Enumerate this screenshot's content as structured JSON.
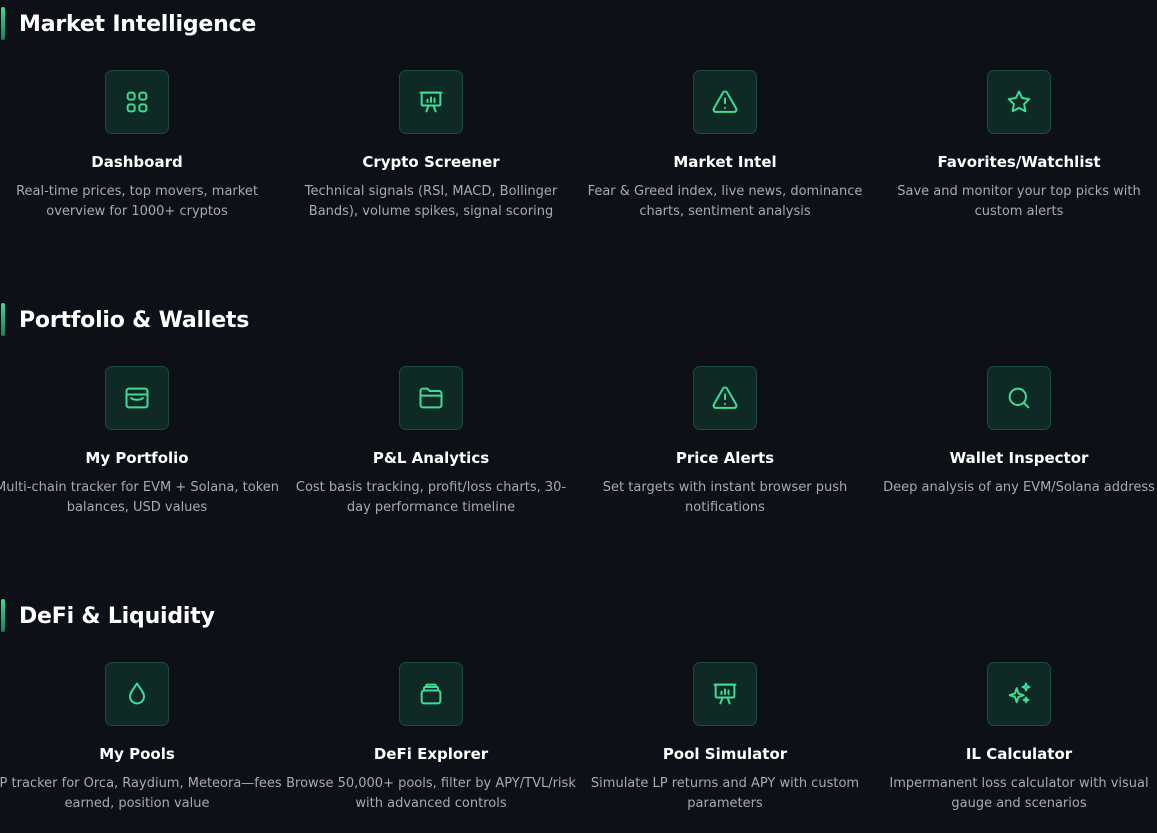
{
  "sections": [
    {
      "title": "Market Intelligence",
      "cards": [
        {
          "icon": "grid-icon",
          "title": "Dashboard",
          "desc": "Real-time prices, top movers, market overview for 1000+ cryptos"
        },
        {
          "icon": "presentation-chart-icon",
          "title": "Crypto Screener",
          "desc": "Technical signals (RSI, MACD, Bollinger Bands), volume spikes, signal scoring"
        },
        {
          "icon": "warning-triangle-icon",
          "title": "Market Intel",
          "desc": "Fear & Greed index, live news, dominance charts, sentiment analysis"
        },
        {
          "icon": "star-icon",
          "title": "Favorites/Watchlist",
          "desc": "Save and monitor your top picks with custom alerts"
        }
      ]
    },
    {
      "title": "Portfolio & Wallets",
      "cards": [
        {
          "icon": "wallet-icon",
          "title": "My Portfolio",
          "desc": "Multi-chain tracker for EVM + Solana, token balances, USD values"
        },
        {
          "icon": "folder-icon",
          "title": "P&L Analytics",
          "desc": "Cost basis tracking, profit/loss charts, 30-day performance timeline"
        },
        {
          "icon": "warning-triangle-icon",
          "title": "Price Alerts",
          "desc": "Set targets with instant browser push notifications"
        },
        {
          "icon": "search-icon",
          "title": "Wallet Inspector",
          "desc": "Deep analysis of any EVM/Solana address"
        }
      ]
    },
    {
      "title": "DeFi & Liquidity",
      "cards": [
        {
          "icon": "droplet-icon",
          "title": "My Pools",
          "desc": "LP tracker for Orca, Raydium, Meteora—fees earned, position value"
        },
        {
          "icon": "stack-icon",
          "title": "DeFi Explorer",
          "desc": "Browse 50,000+ pools, filter by APY/TVL/risk with advanced controls"
        },
        {
          "icon": "presentation-chart-icon",
          "title": "Pool Simulator",
          "desc": "Simulate LP returns and APY with custom parameters"
        },
        {
          "icon": "sparkles-icon",
          "title": "IL Calculator",
          "desc": "Impermanent loss calculator with visual gauge and scenarios"
        }
      ]
    }
  ],
  "colors": {
    "background": "#0d1016",
    "accent": "#3ddc97",
    "icon_bg": "#0f2a24",
    "desc_text": "#a4abb6"
  }
}
